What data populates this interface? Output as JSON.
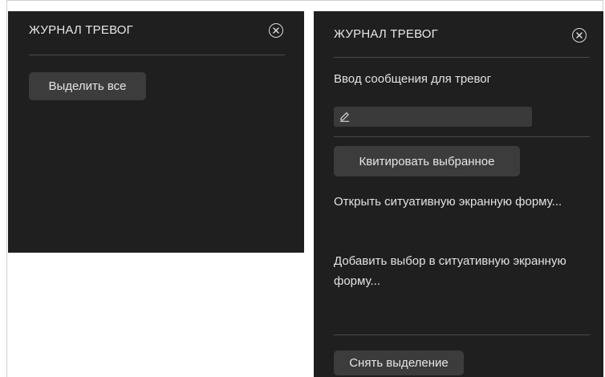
{
  "left_panel": {
    "title": "ЖУРНАЛ ТРЕВОГ",
    "close_icon": "close-circle-icon",
    "select_all_label": "Выделить все"
  },
  "right_panel": {
    "title": "ЖУРНАЛ ТРЕВОГ",
    "close_icon": "close-circle-icon",
    "message_label": "Ввод сообщения для тревог",
    "message_input": {
      "value": "",
      "icon": "pencil-icon"
    },
    "acknowledge_label": "Квитировать выбранное",
    "open_form_label": "Открыть ситуативную экранную форму...",
    "add_to_form_label": "Добавить выбор в ситуативную экранную форму...",
    "deselect_label": "Снять выделение"
  },
  "colors": {
    "panel_bg": "#1f1f1f",
    "button_bg": "#3c3c3c",
    "divider": "#4a4a4a",
    "text": "#e6e6e6",
    "page_bg": "#ffffff"
  }
}
